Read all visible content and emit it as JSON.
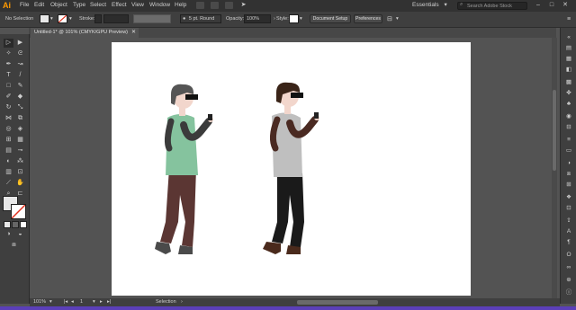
{
  "app": {
    "logo": "Ai"
  },
  "menubar": {
    "items": [
      "File",
      "Edit",
      "Object",
      "Type",
      "Select",
      "Effect",
      "View",
      "Window",
      "Help"
    ],
    "workspace": "Essentials",
    "workspace_chevron": "▾",
    "search_placeholder": "Search Adobe Stock",
    "window_controls": [
      "–",
      "□",
      "✕"
    ]
  },
  "controlbar": {
    "selection_label": "No Selection",
    "stroke_label": "Stroke:",
    "brush_label": "5 pt. Round",
    "opacity_label": "Opacity:",
    "opacity_value": "100%",
    "style_label": "Style:",
    "document_setup": "Document Setup",
    "preferences": "Preferences"
  },
  "document": {
    "tab_title": "Untitled-1* @ 101% (CMYK/GPU Preview)",
    "tab_close": "✕"
  },
  "statusbar": {
    "zoom": "101%",
    "artboard_number": "1",
    "tool": "Selection"
  },
  "colors": {
    "accent": "#ff9a00",
    "shirt_left": "#85c39e",
    "pants_left": "#5b3633",
    "shirt_right": "#bfbfbf",
    "pants_right": "#1a1a1a",
    "sleeve_left": "#3b3b3b",
    "sleeve_right": "#4a2a22",
    "skin": "#f2d6cc"
  }
}
